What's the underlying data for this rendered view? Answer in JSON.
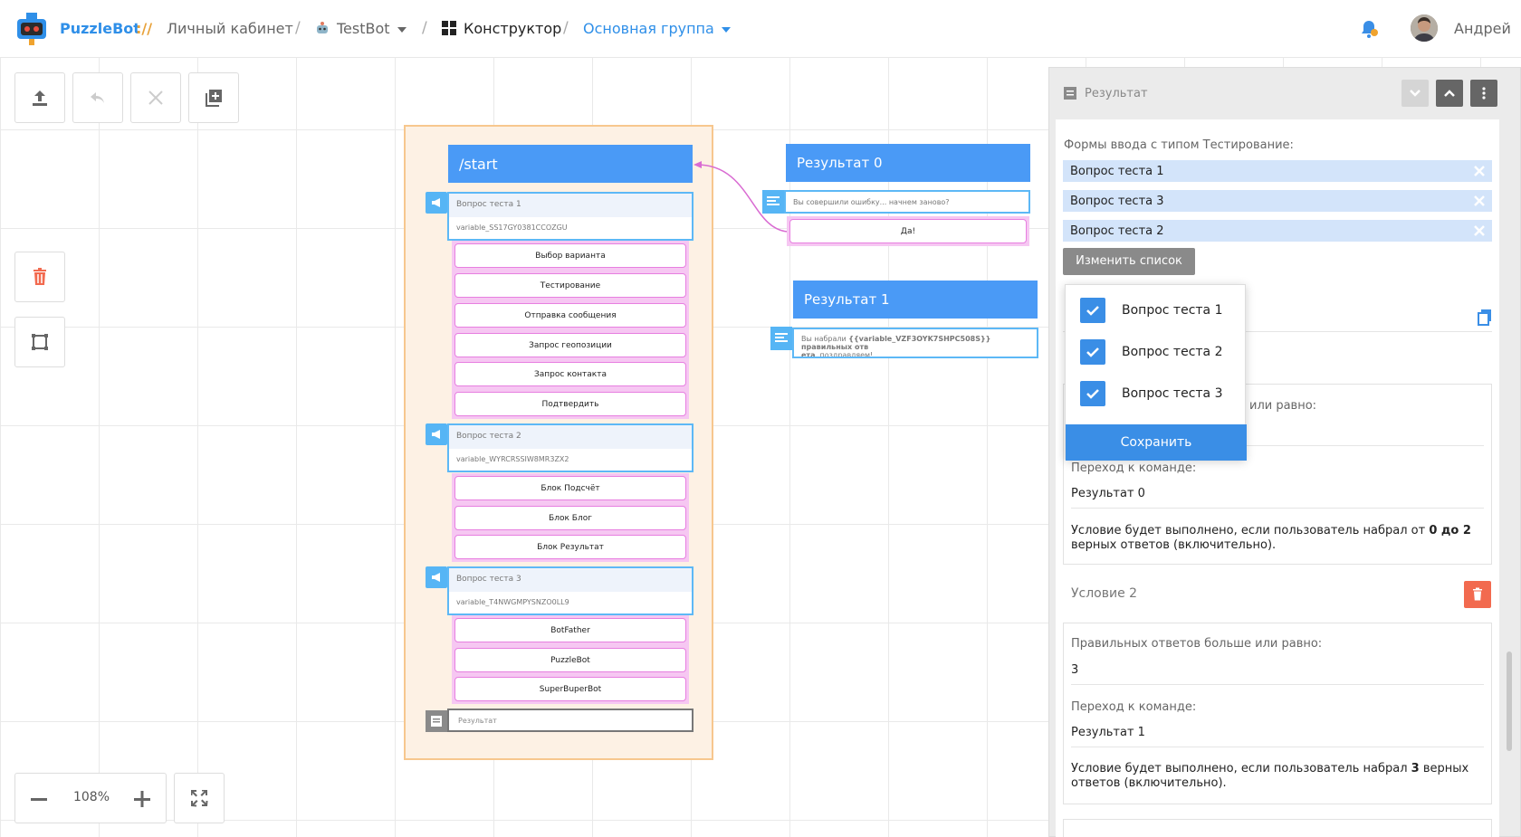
{
  "header": {
    "brand": "PuzzleBot",
    "brand_sep": "://",
    "cabinet": "Личный кабинет",
    "bot": "TestBot",
    "constructor": "Конструктор",
    "group": "Основная группа",
    "user": "Андрей"
  },
  "canvas": {
    "zoom": "108%",
    "start": "/start",
    "questions": [
      {
        "title": "Вопрос теста 1",
        "var": "variable_SS17GY0381CCOZGU",
        "options": [
          "Выбор варианта",
          "Тестирование",
          "Отправка сообщения",
          "Запрос геопозиции",
          "Запрос контакта",
          "Подтвердить"
        ]
      },
      {
        "title": "Вопрос теста 2",
        "var": "variable_WYRCRSSIW8MR3ZX2",
        "options": [
          "Блок Подсчёт",
          "Блок Блог",
          "Блок Результат"
        ]
      },
      {
        "title": "Вопрос теста 3",
        "var": "variable_T4NWGMPYSNZO0LL9",
        "options": [
          "BotFather",
          "PuzzleBot",
          "SuperBuperBot"
        ]
      }
    ],
    "result_block": "Результат",
    "result0": {
      "title": "Результат 0",
      "text": "Вы совершили ошибку... начнем заново?",
      "button": "Да!"
    },
    "result1": {
      "title": "Результат 1",
      "text_a": "Вы набрали ",
      "text_b": "{{variable_VZF3OYK7SHPC508S}}",
      "text_c": " правильных отв",
      "text_d": "ета",
      "text_e": ", поздравляем!"
    }
  },
  "panel": {
    "title": "Результат",
    "forms_label": "Формы ввода с типом Тестирование:",
    "chips": [
      "Вопрос теста 1",
      "Вопрос теста 3",
      "Вопрос теста 2"
    ],
    "change_button": "Изменить список",
    "popup": {
      "items": [
        "Вопрос теста 1",
        "Вопрос теста 2",
        "Вопрос теста 3"
      ],
      "save": "Сохранить"
    },
    "cond1": {
      "partial_label": "или равно:",
      "goto_label": "Переход к команде:",
      "goto_value": "Результат 0",
      "desc_a": "Условие будет выполнено, если пользователь набрал от ",
      "desc_b": "0 до 2",
      "desc_c": "верных ответов (включительно)."
    },
    "cond2": {
      "header": "Условие  2",
      "min_label": "Правильных ответов больше или равно:",
      "min_value": "3",
      "goto_label": "Переход к команде:",
      "goto_value": "Результат 1",
      "desc_a": "Условие будет выполнено, если пользователь набрал ",
      "desc_b": "3",
      "desc_c": " верных",
      "desc_d": "ответов (включительно)."
    }
  }
}
